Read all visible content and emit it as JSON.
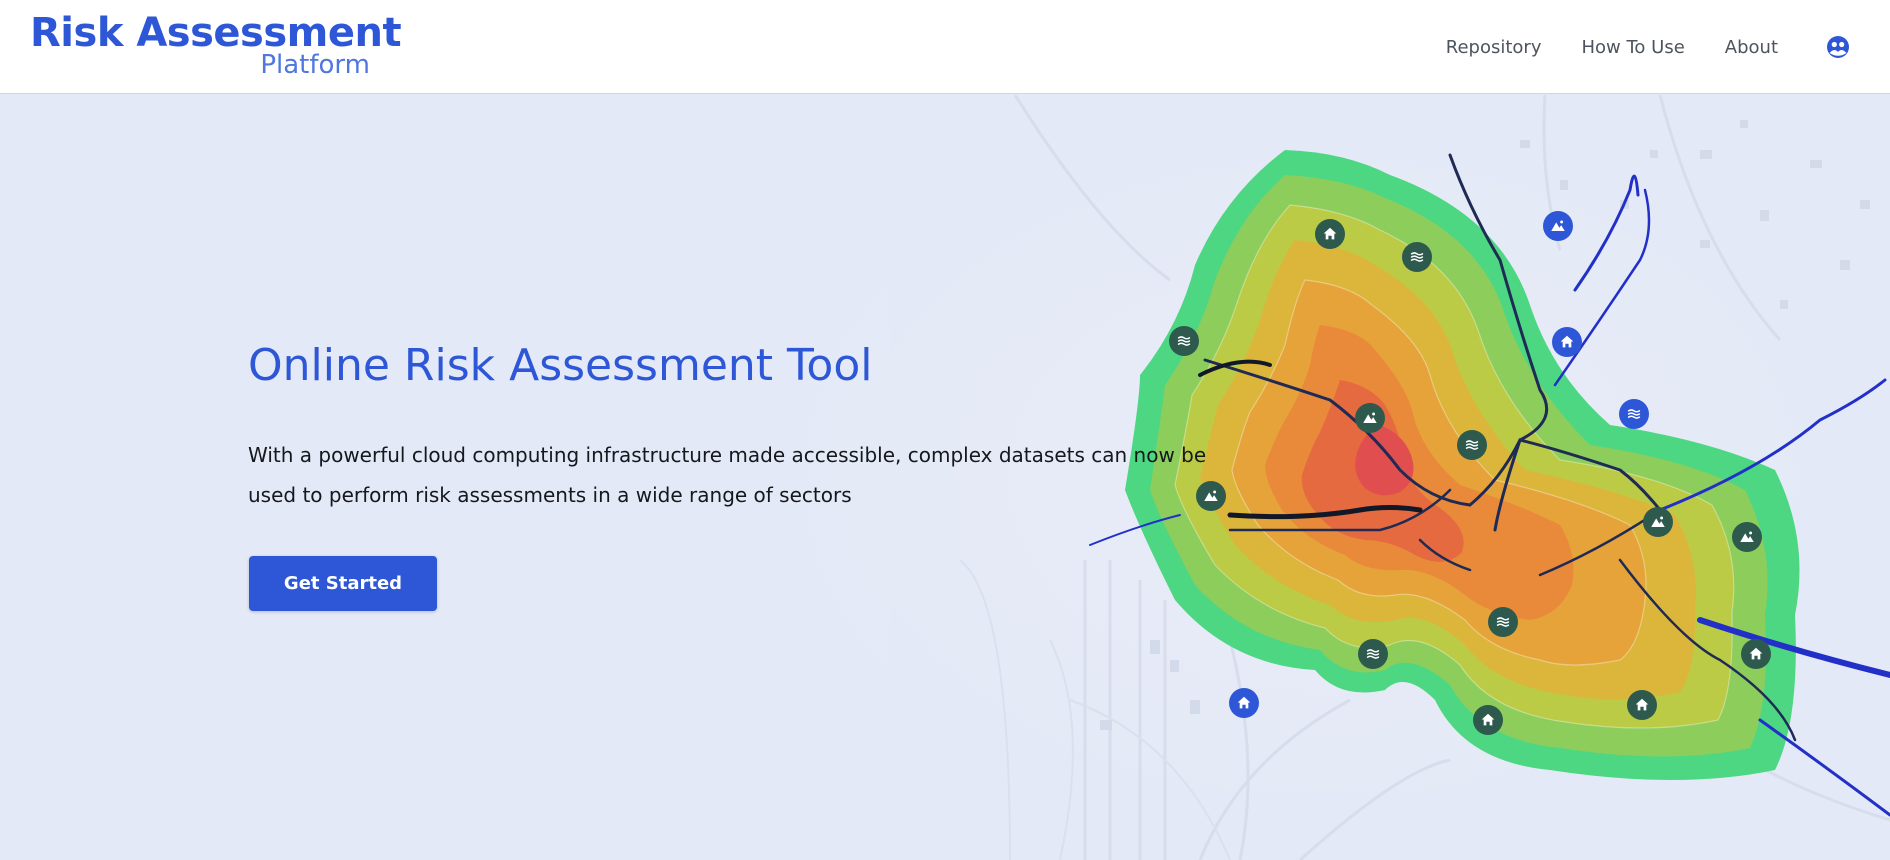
{
  "header": {
    "logo_title": "Risk Assessment",
    "logo_subtitle": "Platform",
    "nav": [
      "Repository",
      "How To Use",
      "About"
    ],
    "user_icon": "user-circle-icon"
  },
  "hero": {
    "title": "Online Risk Assessment Tool",
    "description": "With a powerful cloud computing infrastructure made accessible, complex datasets can now be used to perform risk assessments in a wide range of sectors",
    "cta_label": "Get Started"
  },
  "map": {
    "zone_colors": [
      "#4dd782",
      "#8ccd5c",
      "#bccb45",
      "#dcb63a",
      "#e6a33a",
      "#e88a3a",
      "#e56a3f",
      "#e04e4f"
    ],
    "marker_icons": [
      "home-icon",
      "water-icon",
      "mountain-icon"
    ],
    "marker_colors": {
      "inside": "#2e5a4e",
      "outside": "#2d57d6"
    },
    "road_color": "#1e2a8f"
  },
  "colors": {
    "brand": "#2d57d6",
    "background": "#e4e9f7"
  }
}
